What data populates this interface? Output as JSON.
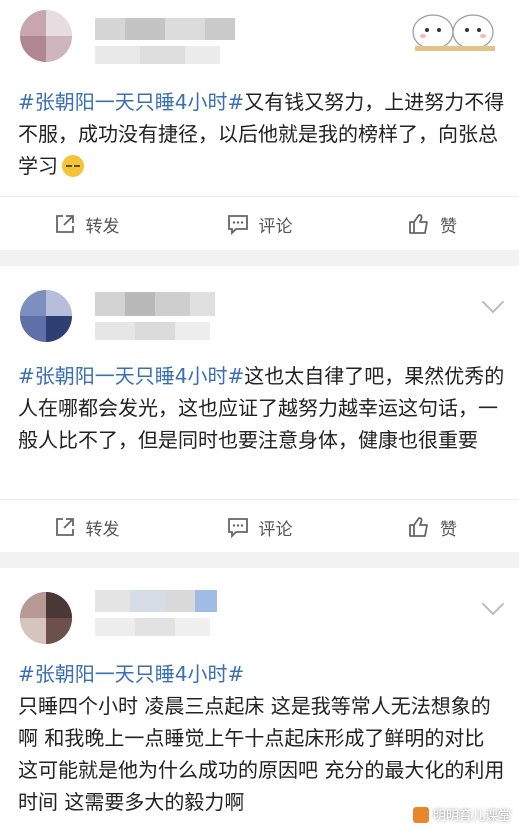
{
  "posts": [
    {
      "hashtag": "#张朝阳一天只睡4小时#",
      "text": "又有钱又努力，上进努力不得不服，成功没有捷径，以后他就是我的榜样了，向张总学习",
      "emoji": "sweat-smile-emoji"
    },
    {
      "hashtag": "#张朝阳一天只睡4小时#",
      "text": "这也太自律了吧，果然优秀的人在哪都会发光，这也应证了越努力越幸运这句话，一般人比不了，但是同时也要注意身体，健康也很重要"
    },
    {
      "hashtag": "#张朝阳一天只睡4小时#",
      "text": "只睡四个小时 凌晨三点起床 这是我等常人无法想象的啊 和我晚上一点睡觉上午十点起床形成了鲜明的对比 这可能就是他为什么成功的原因吧 充分的最大化的利用时间 这需要多大的毅力啊"
    }
  ],
  "actions": {
    "repost": "转发",
    "comment": "评论",
    "like": "赞"
  },
  "watermark": "明明育儿课堂",
  "colors": {
    "hashtag": "#3a6fb4",
    "background": "#f2f2f2",
    "card": "#ffffff"
  }
}
